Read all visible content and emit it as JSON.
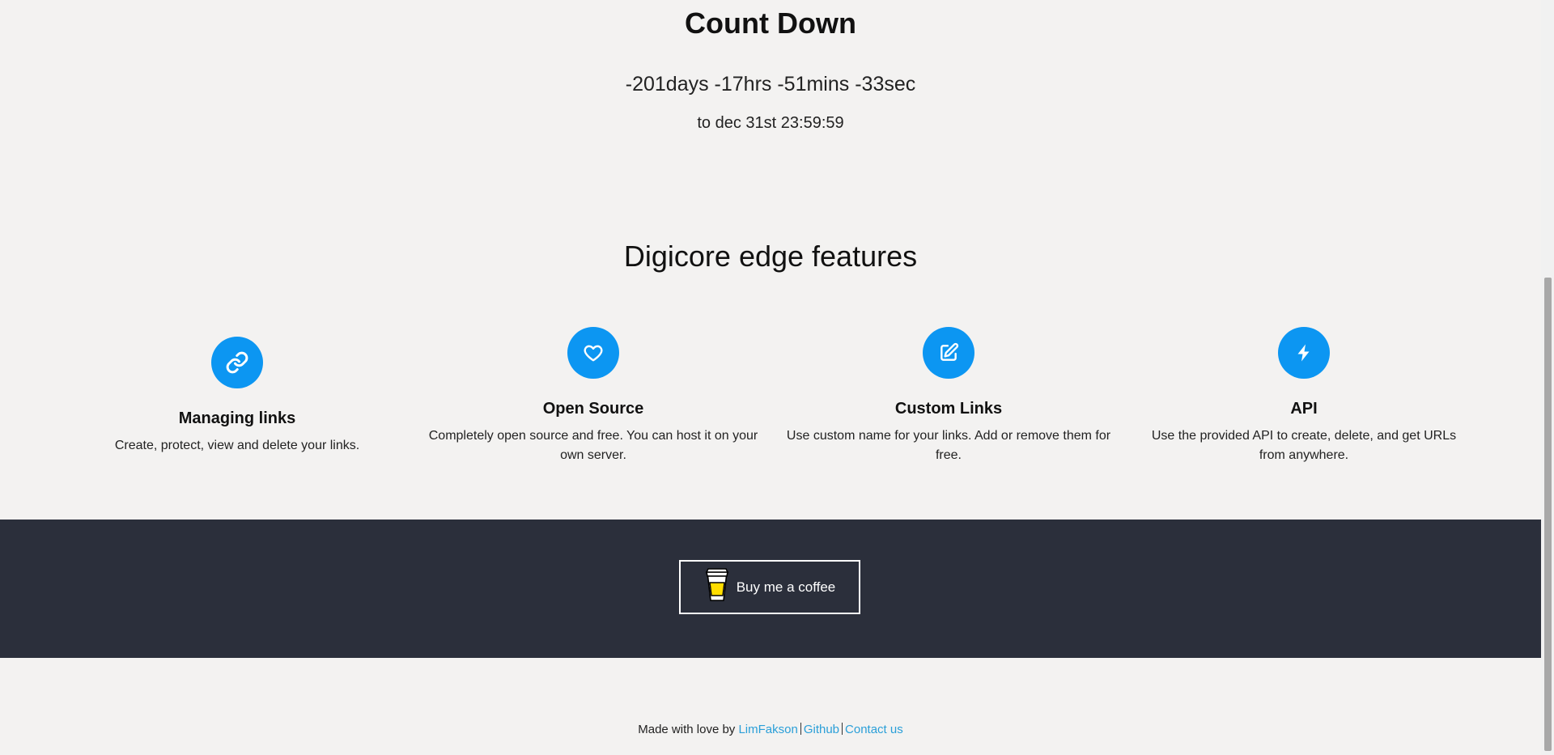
{
  "countdown": {
    "title": "Count Down",
    "value": "-201days -17hrs -51mins -33sec",
    "target": "to dec 31st 23:59:59"
  },
  "features": {
    "title": "Digicore edge features",
    "items": [
      {
        "icon": "link-icon",
        "name": "Managing links",
        "desc": "Create, protect, view and delete your links."
      },
      {
        "icon": "heart-icon",
        "name": "Open Source",
        "desc": "Completely open source and free. You can host it on your own server."
      },
      {
        "icon": "edit-icon",
        "name": "Custom Links",
        "desc": "Use custom name for your links. Add or remove them for free."
      },
      {
        "icon": "bolt-icon",
        "name": "API",
        "desc": "Use the provided API to create, delete, and get URLs from anywhere."
      }
    ]
  },
  "coffee": {
    "label": "Buy me a coffee",
    "icon": "coffee-cup-icon"
  },
  "footer": {
    "prefix": "Made with love by ",
    "author_link": "LimFakson",
    "github_link": "Github",
    "contact_link": "Contact us"
  },
  "colors": {
    "accent": "#0c96f2",
    "dark_band": "#2b2f3b",
    "link": "#2a9fd8",
    "background": "#f3f2f1"
  }
}
